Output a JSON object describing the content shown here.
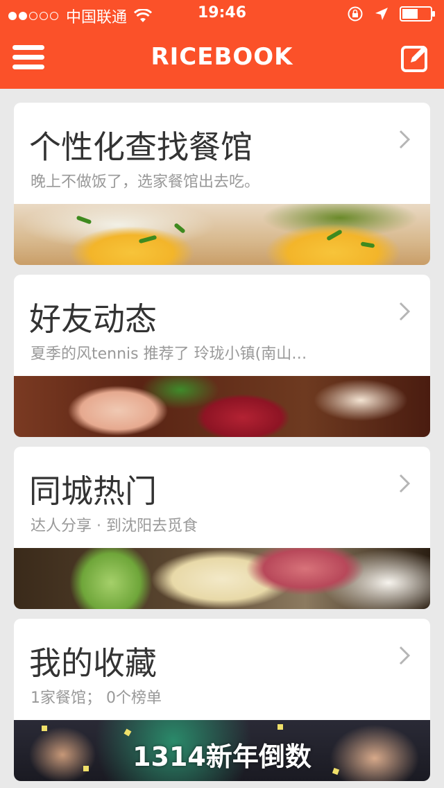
{
  "status_bar": {
    "carrier": "中国联通",
    "time": "19:46"
  },
  "navbar": {
    "title": "RICEBOOK"
  },
  "cards": [
    {
      "title": "个性化查找餐馆",
      "subtitle": "晚上不做饭了，选家餐馆出去吃。"
    },
    {
      "title": "好友动态",
      "subtitle": "夏季的风tennis 推荐了 玲珑小镇(南山…"
    },
    {
      "title": "同城热门",
      "subtitle": "达人分享 · 到沈阳去觅食"
    },
    {
      "title": "我的收藏",
      "subtitle": "1家餐馆；  0个榜单",
      "banner_text": "1314新年倒数"
    }
  ],
  "colors": {
    "brand": "#fb5129",
    "background": "#e9e9e9"
  }
}
